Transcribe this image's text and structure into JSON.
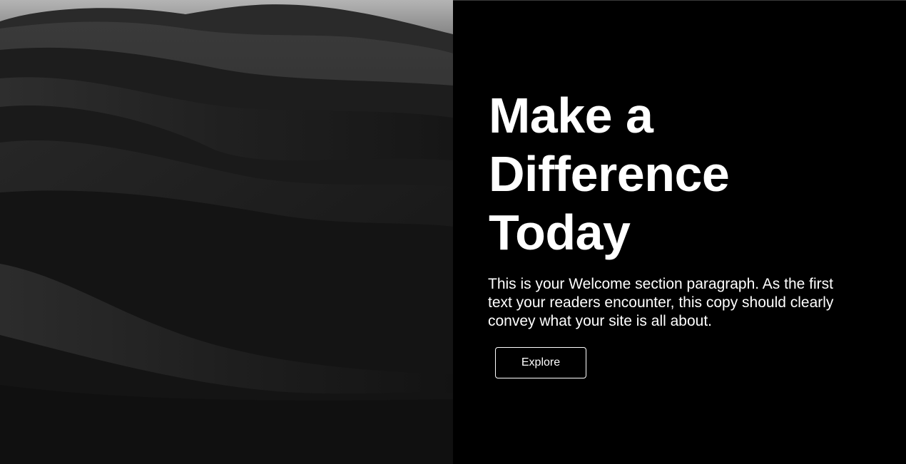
{
  "hero": {
    "image": {
      "alt": "black and white desert dunes",
      "colors": {
        "sky": "#9a9a9a",
        "dune_light": "#2c2c2c",
        "dune_dark": "#111111"
      }
    },
    "headline_lines": [
      "Make a",
      "Difference",
      "Today"
    ],
    "paragraph": "This is your Welcome section paragraph. As the first text your readers encounter, this copy should clearly convey what your site is all about.",
    "button_label": "Explore",
    "colors": {
      "background": "#000000",
      "text": "#ffffff",
      "button_border": "#ffffff"
    }
  }
}
